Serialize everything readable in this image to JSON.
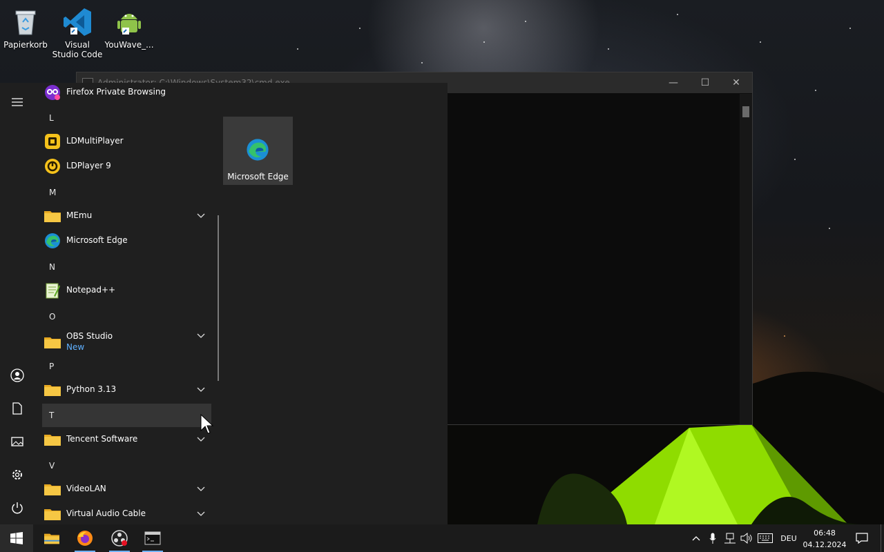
{
  "desktop": {
    "icons": [
      {
        "label": "Papierkorb",
        "icon": "recycle-bin-icon"
      },
      {
        "label": "Visual Studio Code",
        "icon": "vscode-icon"
      },
      {
        "label": "YouWave_...",
        "icon": "android-icon"
      }
    ]
  },
  "console": {
    "title": "Administrator: C:\\Windows\\System32\\cmd.exe",
    "buttons": {
      "minimize": "—",
      "maximize": "☐",
      "close": "✕"
    }
  },
  "start_menu": {
    "top_app": {
      "label": "Firefox Private Browsing",
      "icon": "firefox-private-icon"
    },
    "groups": [
      {
        "letter": "L",
        "apps": [
          {
            "label": "LDMultiPlayer",
            "icon": "ldmultiplayer-icon"
          },
          {
            "label": "LDPlayer 9",
            "icon": "ldplayer-icon"
          }
        ]
      },
      {
        "letter": "M",
        "apps": [
          {
            "label": "MEmu",
            "icon": "folder-icon",
            "expandable": true
          },
          {
            "label": "Microsoft Edge",
            "icon": "edge-icon"
          }
        ]
      },
      {
        "letter": "N",
        "apps": [
          {
            "label": "Notepad++",
            "icon": "notepadpp-icon"
          }
        ]
      },
      {
        "letter": "O",
        "apps": [
          {
            "label": "OBS Studio",
            "sublabel": "New",
            "icon": "folder-icon",
            "expandable": true
          }
        ]
      },
      {
        "letter": "P",
        "apps": [
          {
            "label": "Python 3.13",
            "icon": "folder-icon",
            "expandable": true
          }
        ]
      },
      {
        "letter": "T",
        "apps": [
          {
            "label": "Tencent Software",
            "icon": "folder-icon",
            "expandable": true
          }
        ]
      },
      {
        "letter": "V",
        "apps": [
          {
            "label": "VideoLAN",
            "icon": "folder-icon",
            "expandable": true
          },
          {
            "label": "Virtual Audio Cable",
            "icon": "folder-icon",
            "expandable": true
          }
        ]
      }
    ],
    "pinned_tile": {
      "label": "Microsoft Edge",
      "icon": "edge-icon"
    },
    "rail": [
      "hamburger-icon",
      "user-icon",
      "documents-icon",
      "pictures-icon",
      "settings-icon",
      "power-icon"
    ]
  },
  "taskbar": {
    "pinned": [
      "start-icon",
      "file-explorer-icon",
      "firefox-icon",
      "obs-icon",
      "terminal-icon"
    ],
    "tray": {
      "language": "DEU",
      "time": "06:48",
      "date": "04.12.2024"
    }
  },
  "colors": {
    "accent": "#6fb2ff",
    "start_bg": "#1f1f1f",
    "folder": "#f3c33f",
    "tent_green": "#9be800"
  }
}
